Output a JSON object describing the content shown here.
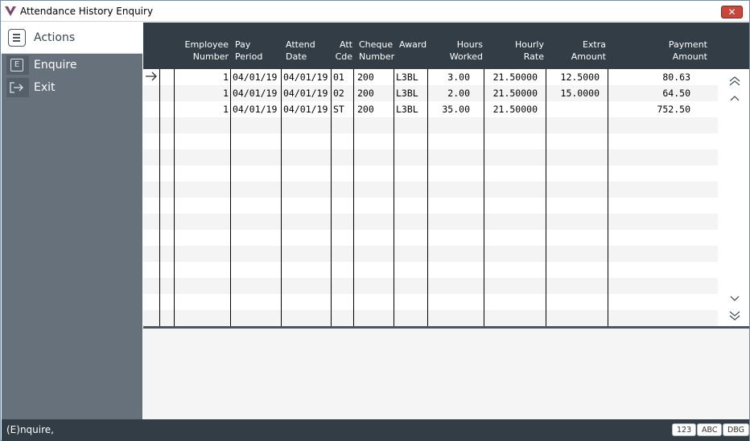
{
  "window": {
    "title": "Attendance History Enquiry",
    "close_label": "✕"
  },
  "sidebar": {
    "header": "Actions",
    "items": [
      {
        "key": "E",
        "label": "Enquire"
      },
      {
        "key": "",
        "label": "Exit"
      }
    ]
  },
  "grid": {
    "columns": [
      {
        "id": "employee_number",
        "line1": "Employee",
        "line2": "Number"
      },
      {
        "id": "pay_period",
        "line1": "Pay",
        "line2": "Period"
      },
      {
        "id": "attend_date",
        "line1": "Attend",
        "line2": "Date"
      },
      {
        "id": "att_cde",
        "line1": "Att",
        "line2": "Cde"
      },
      {
        "id": "cheque_number",
        "line1": "Cheque",
        "line2": "Number"
      },
      {
        "id": "award",
        "line1": "Award",
        "line2": ""
      },
      {
        "id": "hours_worked",
        "line1": "Hours",
        "line2": "Worked"
      },
      {
        "id": "hourly_rate",
        "line1": "Hourly",
        "line2": "Rate"
      },
      {
        "id": "extra_amount",
        "line1": "Extra",
        "line2": "Amount"
      },
      {
        "id": "payment_amount",
        "line1": "Payment",
        "line2": "Amount"
      }
    ],
    "rows": [
      {
        "employee_number": "1",
        "pay_period": "04/01/19",
        "attend_date": "04/01/19",
        "att_cde": "01",
        "cheque_number": "200",
        "award": "L3BL",
        "hours_worked": "3.00",
        "hourly_rate": "21.50000",
        "extra_amount": "12.5000",
        "payment_amount": "80.63"
      },
      {
        "employee_number": "1",
        "pay_period": "04/01/19",
        "attend_date": "04/01/19",
        "att_cde": "02",
        "cheque_number": "200",
        "award": "L3BL",
        "hours_worked": "2.00",
        "hourly_rate": "21.50000",
        "extra_amount": "15.0000",
        "payment_amount": "64.50"
      },
      {
        "employee_number": "1",
        "pay_period": "04/01/19",
        "attend_date": "04/01/19",
        "att_cde": "ST",
        "cheque_number": "200",
        "award": "L3BL",
        "hours_worked": "35.00",
        "hourly_rate": "21.50000",
        "extra_amount": "",
        "payment_amount": "752.50"
      }
    ]
  },
  "status": {
    "text": "(E)nquire,",
    "badges": [
      "123",
      "ABC",
      "DBG"
    ]
  },
  "colors": {
    "sidebar_bg": "#66717c",
    "header_bg": "#333d46",
    "close_button": "#c9473a"
  }
}
